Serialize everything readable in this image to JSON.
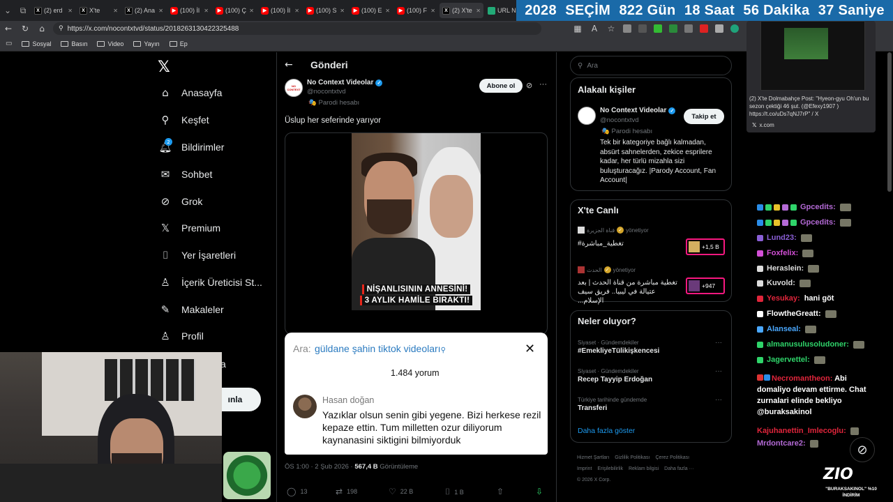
{
  "browser": {
    "tabs": [
      {
        "icon": "x",
        "label": "(2) erd"
      },
      {
        "icon": "x",
        "label": "X'te"
      },
      {
        "icon": "x",
        "label": "(2) Ana"
      },
      {
        "icon": "yt",
        "label": "(100) İl"
      },
      {
        "icon": "yt",
        "label": "(100) Ç"
      },
      {
        "icon": "yt",
        "label": "(100) İl"
      },
      {
        "icon": "yt",
        "label": "(100) S"
      },
      {
        "icon": "yt",
        "label": "(100) E"
      },
      {
        "icon": "yt",
        "label": "(100) F"
      },
      {
        "icon": "x",
        "label": "(2) X'te"
      },
      {
        "icon": "url",
        "label": "URL N"
      }
    ],
    "url": "https://x.com/nocontxtvd/status/2018263130422325488",
    "bookmarks": [
      "Sosyal",
      "Basın",
      "Video",
      "Yayın",
      "Ep"
    ],
    "countdown": {
      "year": "2028",
      "label": "SEÇİM",
      "days": "822 Gün",
      "hours": "18 Saat",
      "minutes": "56 Dakika",
      "seconds": "37 Saniye"
    }
  },
  "nav": {
    "items": [
      {
        "label": "Anasayfa",
        "icon": "home-icon"
      },
      {
        "label": "Keşfet",
        "icon": "search-icon"
      },
      {
        "label": "Bildirimler",
        "icon": "bell-icon",
        "badge": "2"
      },
      {
        "label": "Sohbet",
        "icon": "mail-icon"
      },
      {
        "label": "Grok",
        "icon": "grok-icon"
      },
      {
        "label": "Premium",
        "icon": "x-icon"
      },
      {
        "label": "Yer İşaretleri",
        "icon": "bookmark-icon"
      },
      {
        "label": "İçerik Üreticisi St...",
        "icon": "creator-icon"
      },
      {
        "label": "Makaleler",
        "icon": "article-icon"
      },
      {
        "label": "Profil",
        "icon": "user-icon"
      }
    ],
    "partial_item": "a",
    "post_button": "ınla"
  },
  "post": {
    "header_title": "Gönderi",
    "author_name": "No Context Videolar",
    "author_handle": "@nocontxtvd",
    "parody_label": "Parodi hesabı",
    "subscribe_label": "Abone ol",
    "text": "Üslup her seferinde yarıyor",
    "video_caption_1": "NİŞANLISININ ANNESİNİ!",
    "video_caption_2": "3 AYLIK HAMİLE BIRAKTI!",
    "search_overlay": {
      "label": "Ara:",
      "query": "güldane şahin tiktok videoları",
      "comment_count": "1.484 yorum",
      "commenter": "Hasan doğan",
      "comment": "Yazıklar olsun senin gibi yegene. Bizi herkese rezil kepaze ettin. Tum milletten ozur diliyorum kaynanasini siktigini bilmiyorduk"
    },
    "meta_time": "ÖS 1:00 · 2 Şub 2026 ·",
    "meta_views": "567,4 B",
    "meta_views_label": "Görüntüleme",
    "actions": {
      "replies": "13",
      "reposts": "198",
      "likes": "22 B",
      "bookmarks": "1 B"
    }
  },
  "sidebar": {
    "search_placeholder": "Ara",
    "related_title": "Alakalı kişiler",
    "related": {
      "name": "No Context Videolar",
      "handle": "@nocontxtvd",
      "parody": "Parodi hesabı",
      "follow_label": "Takip et",
      "bio": "Tek bir kategoriye bağlı kalmadan, absürt sahnelerden, zekice esprilere kadar, her türlü mizahla sizi buluşturacağız. |Parody Account, Fan Account|"
    },
    "live_title": "X'te Canlı",
    "live": [
      {
        "source": "قناة الجزيرة",
        "managing": "yönetiyor",
        "title": "#تغطية_مباشرة",
        "count": "+1,5 B"
      },
      {
        "source": "الحدث",
        "managing": "yönetiyor",
        "title": "تغطية مباشرة من قناة الحدث | بعد عتيالة في ليبيا.. فريق سيف الإسلام...",
        "count": "+947"
      }
    ],
    "trends_title": "Neler oluyor?",
    "trends": [
      {
        "category": "Siyaset · Gündemdekiler",
        "name": "#EmekliyeTülikişkencesi"
      },
      {
        "category": "Siyaset · Gündemdekiler",
        "name": "Recep Tayyip Erdoğan"
      },
      {
        "category": "Türkiye tarihinde gündemde",
        "name": "Transferi"
      }
    ],
    "show_more": "Daha fazla göster",
    "footer": [
      "Hizmet Şartları",
      "Gizlilik Politikası",
      "Çerez Politikası",
      "Imprint",
      "Erişilebilirlik",
      "Reklam bilgisi",
      "Daha fazla ···",
      "© 2026 X Corp."
    ]
  },
  "overlay": {
    "pip_text": "(2) X'te Dolmabahçe Post: \"Hyeon-gyu Oh'un bu sezon çektiği 46 şut. (@Efexy1907 ) https://t.co/uDs7qNJ7rP\" / X",
    "pip_source": "x.com",
    "chat": [
      {
        "user": "Gpcedits:",
        "color": "#b46ad6",
        "msg": "",
        "pic": true
      },
      {
        "user": "Gpcedits:",
        "color": "#b46ad6",
        "msg": "",
        "pic": true
      },
      {
        "user": "Lund23:",
        "color": "#8a5fd6",
        "msg": "",
        "pic": true
      },
      {
        "user": "Foxfelix:",
        "color": "#d34fd6",
        "msg": "",
        "pic": true
      },
      {
        "user": "Heraslein:",
        "color": "#dddddd",
        "msg": "",
        "pic": true
      },
      {
        "user": "Kuvold:",
        "color": "#dddddd",
        "msg": "",
        "pic": true
      },
      {
        "user": "Yesukay:",
        "color": "#e0253b",
        "msg": "hani göt",
        "pic": false
      },
      {
        "user": "FlowtheGreatt:",
        "color": "#ffffff",
        "msg": "",
        "pic": true
      },
      {
        "user": "Alanseal:",
        "color": "#4aa8ff",
        "msg": "",
        "pic": true
      },
      {
        "user": "almanusulusoludoner:",
        "color": "#2fd46a",
        "msg": "",
        "pic": true
      },
      {
        "user": "Jagervettel:",
        "color": "#2fd46a",
        "msg": "",
        "pic": true
      }
    ],
    "long_user": "Necromantheon:",
    "long_msg": "Abi domaliyo devam ettirme. Chat zurnalari elinde bekliyo @buraksakinol",
    "chat2": [
      {
        "user": "Kajuhanettin_Imlecoglu:",
        "color": "#e0253b"
      },
      {
        "user": "Mrdontcare2:",
        "color": "#b46ad6"
      }
    ],
    "brand": "ZIO",
    "brand_sub": "\"BURAKSAKINOL\" %10 İNDİRİM"
  }
}
